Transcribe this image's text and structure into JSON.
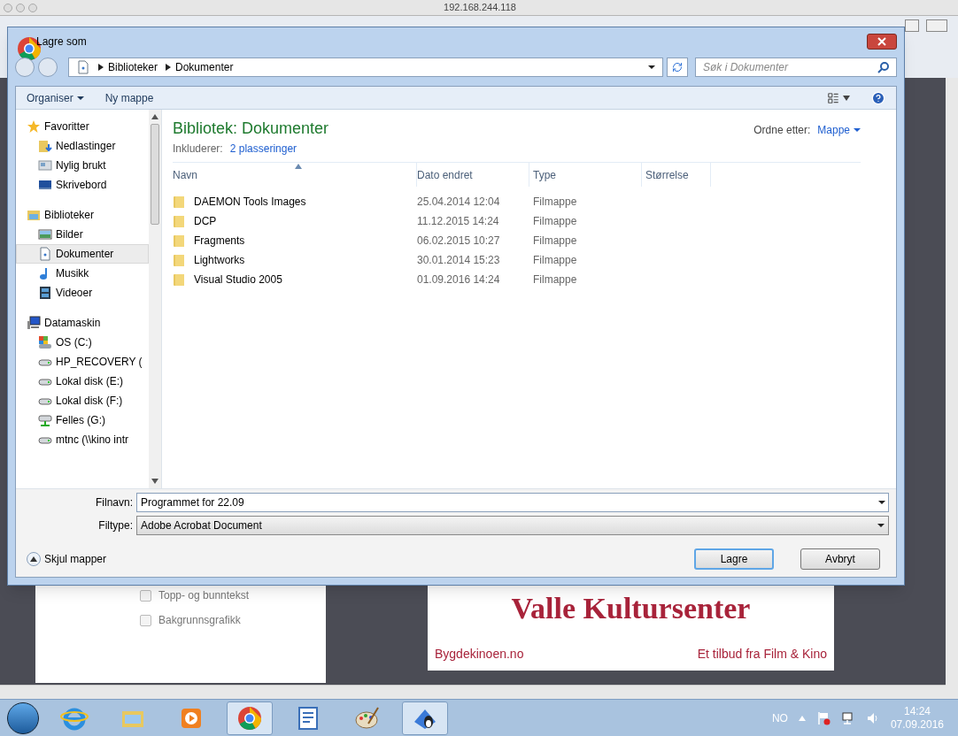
{
  "host_window": {
    "title": "192.168.244.118"
  },
  "dialog": {
    "title": "Lagre som",
    "breadcrumb": [
      "Biblioteker",
      "Dokumenter"
    ],
    "search": {
      "placeholder": "Søk i Dokumenter"
    },
    "toolbar": [
      {
        "label": "Organiser",
        "kind": "menu"
      },
      {
        "label": "Ny mappe",
        "kind": "button"
      }
    ],
    "nav": [
      {
        "label": "Favoritter",
        "children": [
          {
            "label": "Nedlastinger",
            "selected": false
          },
          {
            "label": "Nylig brukt",
            "selected": false
          },
          {
            "label": "Skrivebord",
            "selected": false
          }
        ]
      },
      {
        "label": "Biblioteker",
        "children": [
          {
            "label": "Bilder",
            "selected": false
          },
          {
            "label": "Dokumenter",
            "selected": true
          },
          {
            "label": "Musikk",
            "selected": false
          },
          {
            "label": "Videoer",
            "selected": false
          }
        ]
      },
      {
        "label": "Datamaskin",
        "children": [
          {
            "label": "OS (C:)",
            "selected": false
          },
          {
            "label": "HP_RECOVERY (",
            "selected": false
          },
          {
            "label": "Lokal disk (E:)",
            "selected": false
          },
          {
            "label": "Lokal disk (F:)",
            "selected": false
          },
          {
            "label": "Felles (G:)",
            "selected": false
          },
          {
            "label": "mtnc (\\\\kino intr",
            "selected": false
          }
        ]
      }
    ],
    "library": {
      "title": "Bibliotek: Dokumenter",
      "includes_label": "Inkluderer:",
      "includes_link": "2 plasseringer",
      "arrange_label": "Ordne etter:",
      "arrange_value": "Mappe"
    },
    "columns": [
      {
        "label": "Navn",
        "sorted": true
      },
      {
        "label": "Dato endret",
        "sorted": false
      },
      {
        "label": "Type",
        "sorted": false
      },
      {
        "label": "Størrelse",
        "sorted": false
      }
    ],
    "rows": [
      {
        "name": "DAEMON Tools Images",
        "date": "25.04.2014 12:04",
        "type": "Filmappe"
      },
      {
        "name": "DCP",
        "date": "11.12.2015 14:24",
        "type": "Filmappe"
      },
      {
        "name": "Fragments",
        "date": "06.02.2015 10:27",
        "type": "Filmappe"
      },
      {
        "name": "Lightworks",
        "date": "30.01.2014 15:23",
        "type": "Filmappe"
      },
      {
        "name": "Visual Studio 2005",
        "date": "01.09.2016 14:24",
        "type": "Filmappe"
      }
    ],
    "filename": {
      "label": "Filnavn:",
      "value": "Programmet for 22.09"
    },
    "filetype": {
      "label": "Filtype:",
      "value": "Adobe Acrobat Document"
    },
    "toggle": {
      "label": "Skjul mapper"
    },
    "buttons": [
      {
        "label": "Lagre",
        "default": true
      },
      {
        "label": "Avbryt",
        "default": false
      }
    ]
  },
  "background": {
    "print_options": [
      {
        "label": "Topp- og bunntekst",
        "checked": false
      },
      {
        "label": "Bakgrunnsgrafikk",
        "checked": false
      }
    ],
    "preview": {
      "heading": "Valle Kultursenter",
      "left_text": "Bygdekinoen.no",
      "right_text": "Et tilbud fra Film & Kino"
    }
  },
  "taskbar": {
    "apps": [
      {
        "kind": "ie",
        "active": false
      },
      {
        "kind": "explorer",
        "active": false
      },
      {
        "kind": "media",
        "active": false
      },
      {
        "kind": "chrome",
        "active": true
      },
      {
        "kind": "wordpad",
        "active": false
      },
      {
        "kind": "paint",
        "active": false
      },
      {
        "kind": "penguin",
        "active": true
      }
    ],
    "language": "NO",
    "time": "14:24",
    "date": "07.09.2016"
  }
}
